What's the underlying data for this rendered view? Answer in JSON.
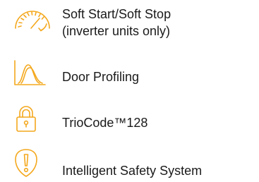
{
  "accent_color": "#f4a81d",
  "text_color": "#1a1a1a",
  "features": [
    {
      "icon": "soft-start-gauge-icon",
      "lines": [
        "Soft Start/Soft Stop",
        "(inverter units only)"
      ]
    },
    {
      "icon": "door-profiling-curve-icon",
      "lines": [
        "Door Profiling"
      ]
    },
    {
      "icon": "padlock-icon",
      "lines": [
        "TrioCode™128"
      ]
    },
    {
      "icon": "exclamation-shield-icon",
      "lines": [
        "Intelligent Safety System"
      ]
    }
  ]
}
